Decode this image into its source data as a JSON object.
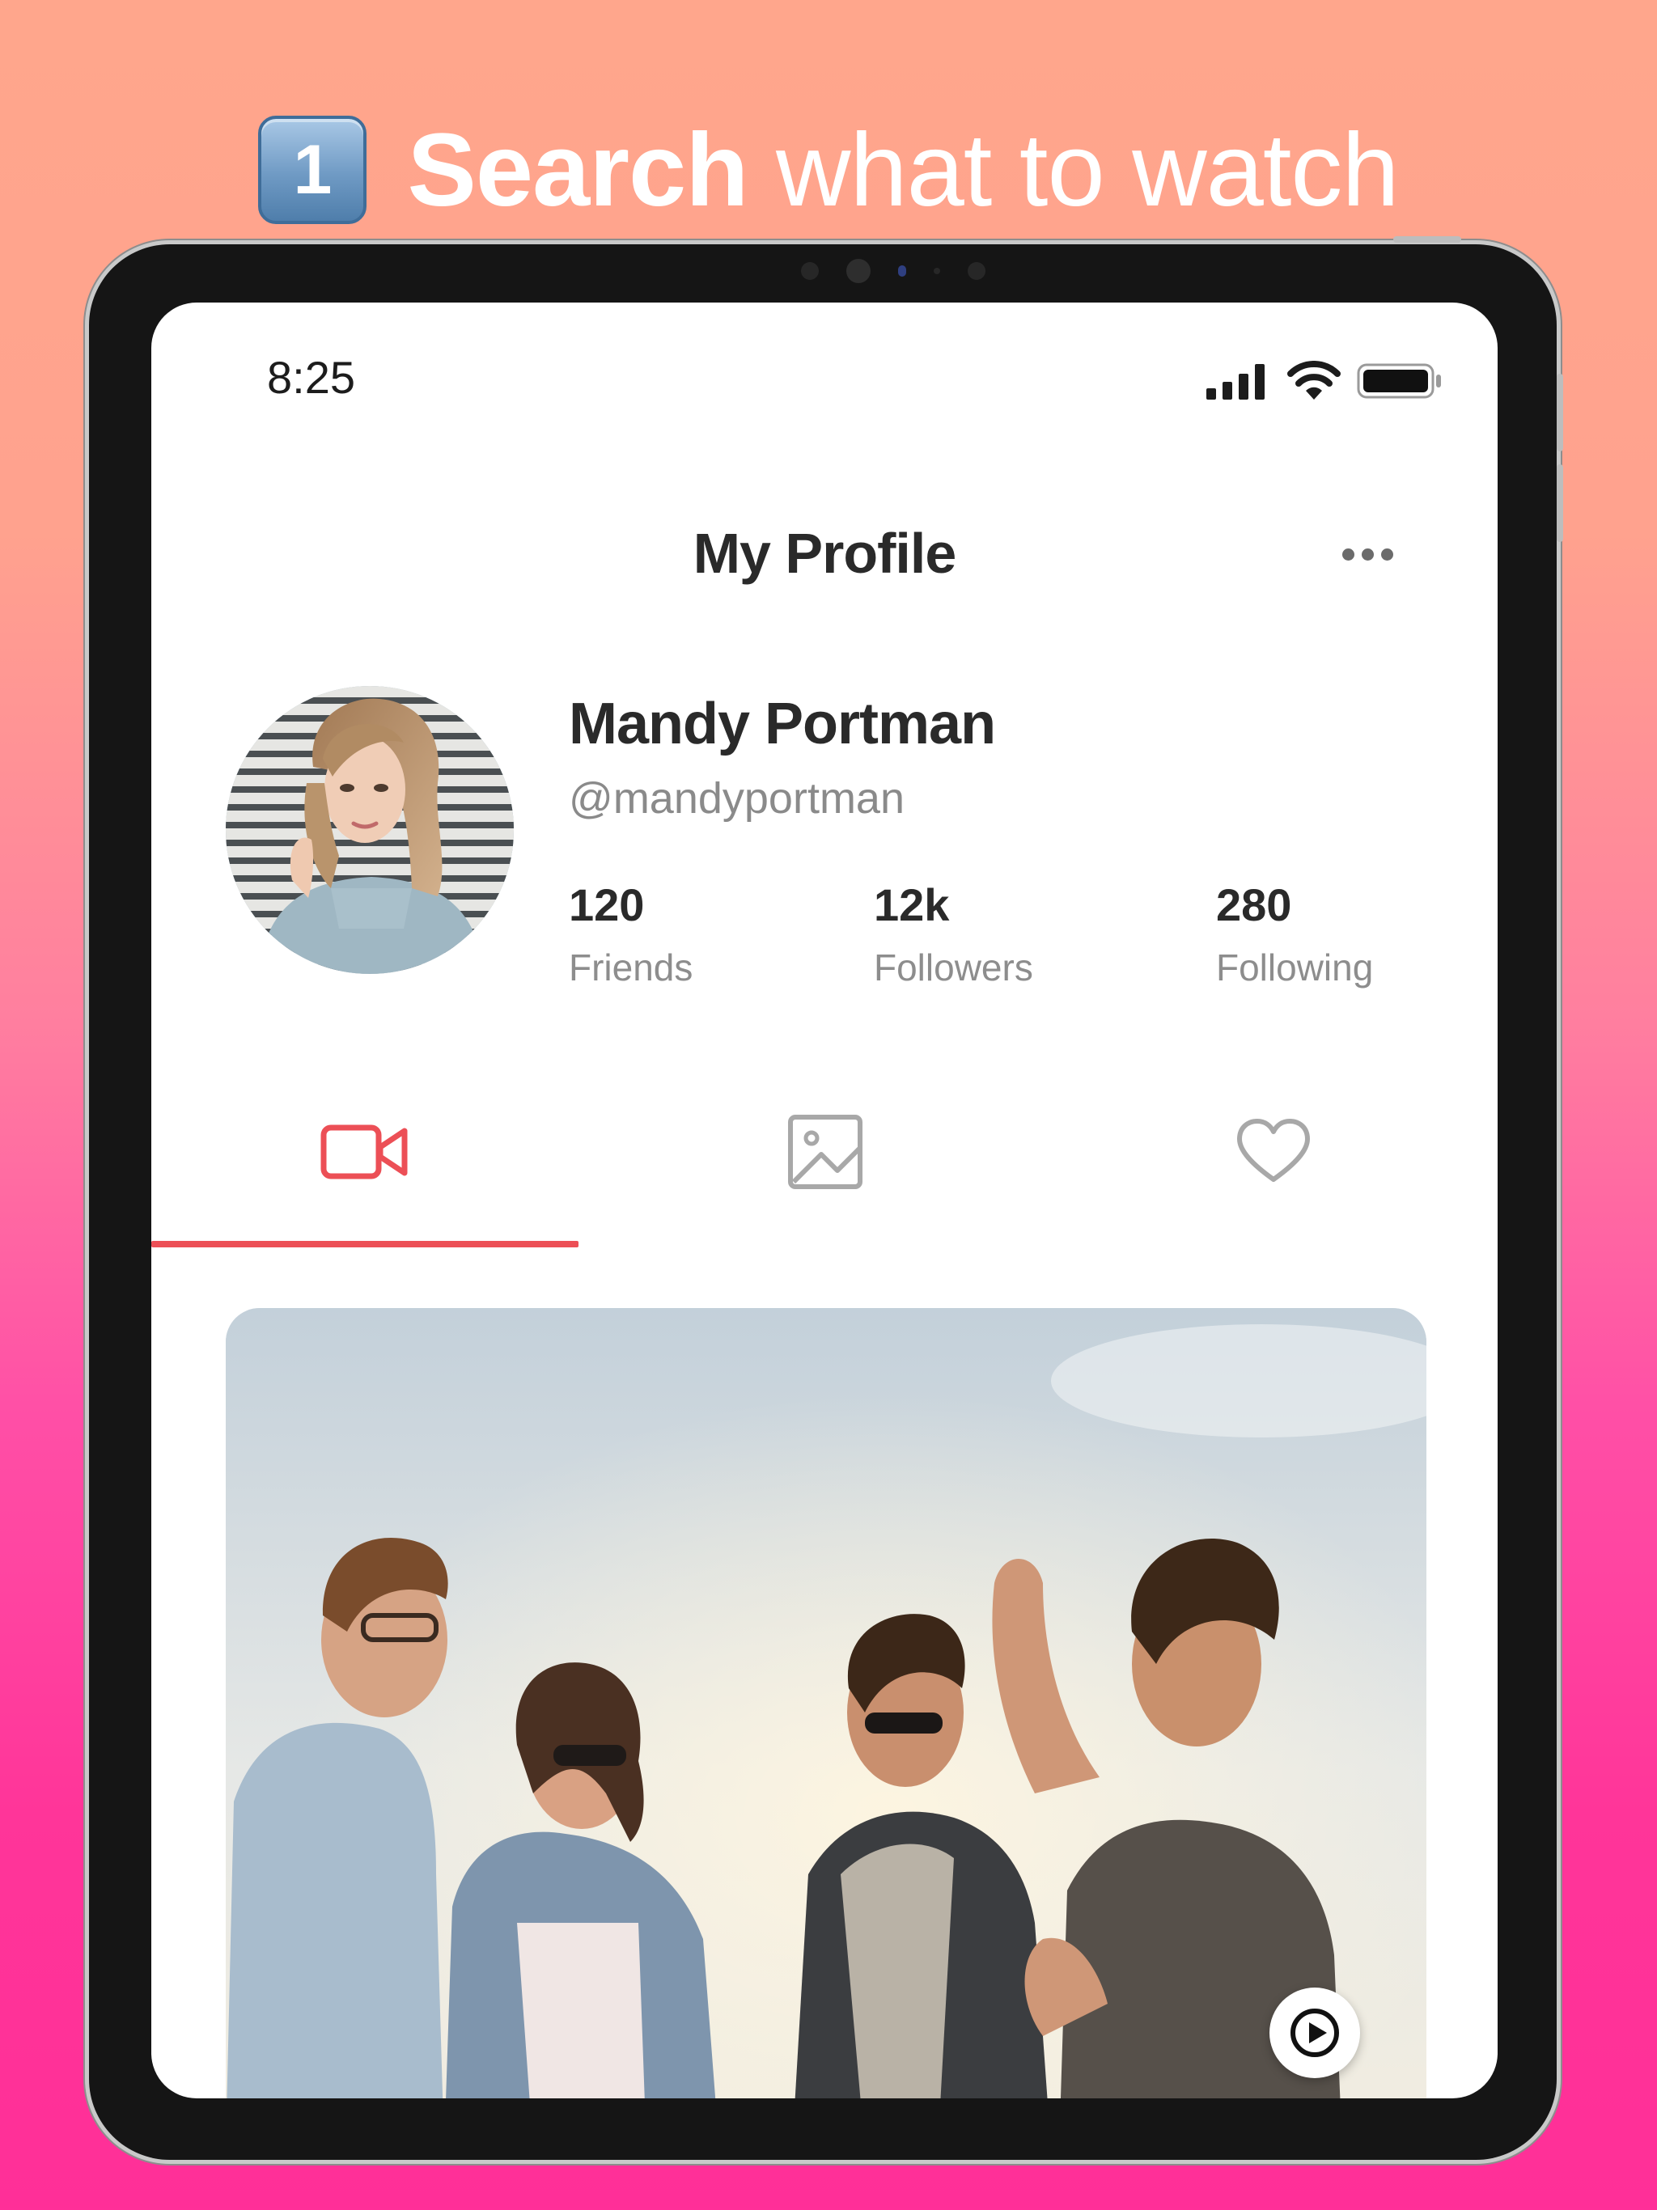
{
  "headline": {
    "badge_number": "1",
    "bold_text": "Search",
    "rest_text": "what to watch"
  },
  "status_bar": {
    "time": "8:25"
  },
  "header": {
    "title": "My Profile"
  },
  "profile": {
    "name": "Mandy Portman",
    "handle": "@mandyportman",
    "stats": [
      {
        "value": "120",
        "label": "Friends"
      },
      {
        "value": "12k",
        "label": "Followers"
      },
      {
        "value": "280",
        "label": "Following"
      }
    ]
  },
  "tabs": [
    {
      "icon": "video-camera-icon",
      "active": true
    },
    {
      "icon": "image-icon",
      "active": false
    },
    {
      "icon": "heart-icon",
      "active": false
    }
  ],
  "colors": {
    "accent": "#ec4f56",
    "background_top": "#ffa68c",
    "background_bottom": "#ff2f98",
    "badge_blue": "#6f9ac4",
    "inactive_icon": "#a8a8a8",
    "text_primary": "#2a2a2a",
    "text_secondary": "#8a8a8a"
  }
}
